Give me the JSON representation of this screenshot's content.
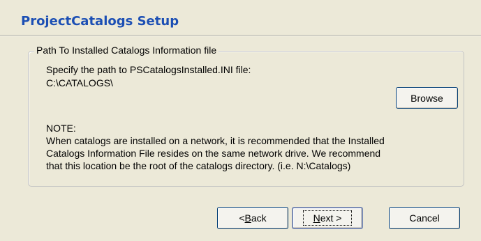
{
  "window": {
    "title": "ProjectCatalogs Setup"
  },
  "group": {
    "legend": "Path To Installed Catalogs Information file",
    "prompt": "Specify the path to PSCatalogsInstalled.INI file:",
    "path_value": "C:\\CATALOGS\\",
    "note_heading": "NOTE:",
    "note_lines": [
      "When catalogs are installed on a network, it is recommended that the Installed",
      "Catalogs Information File resides on the same network drive.  We recommend",
      "that this location be the root of the catalogs directory. (i.e. N:\\Catalogs)"
    ]
  },
  "buttons": {
    "browse": "Browse",
    "back_prefix": "< ",
    "back_accel": "B",
    "back_rest": "ack",
    "next_accel": "N",
    "next_rest": "ext >",
    "cancel": "Cancel"
  },
  "colors": {
    "title": "#1c4fb4",
    "background": "#ece9d8"
  }
}
